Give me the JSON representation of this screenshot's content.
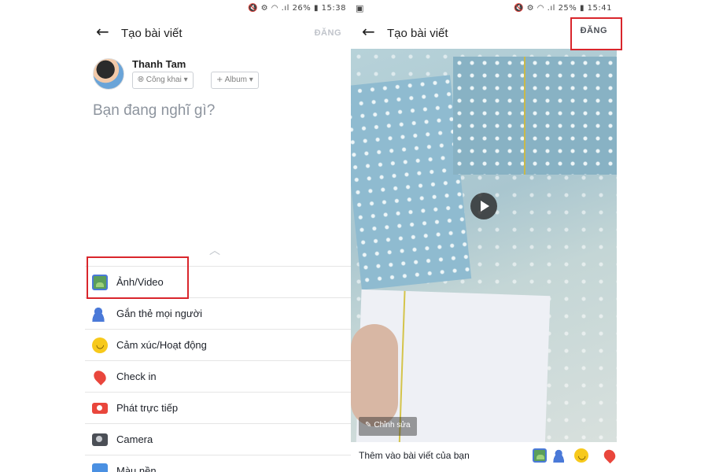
{
  "left": {
    "status": {
      "icons": "🔇 ⚙ 📶 26%",
      "battery": "26%",
      "time": "15:38"
    },
    "header": {
      "back_icon": "arrow-left-icon",
      "title": "Tạo bài viết",
      "post_label": "ĐĂNG"
    },
    "user": {
      "name": "Thanh Tam",
      "privacy": "Công khai",
      "album": "Album"
    },
    "composer_placeholder": "Bạn đang nghĩ gì?",
    "menu": [
      {
        "label": "Ảnh/Video",
        "icon": "photo-video-icon"
      },
      {
        "label": "Gắn thẻ mọi người",
        "icon": "tag-people-icon"
      },
      {
        "label": "Cảm xúc/Hoạt động",
        "icon": "feeling-emoji-icon"
      },
      {
        "label": "Check in",
        "icon": "location-pin-icon"
      },
      {
        "label": "Phát trực tiếp",
        "icon": "live-video-icon"
      },
      {
        "label": "Camera",
        "icon": "camera-icon"
      },
      {
        "label": "Màu nền",
        "icon": "background-color-icon"
      }
    ]
  },
  "right": {
    "status": {
      "battery": "25%",
      "time": "15:41"
    },
    "header": {
      "title": "Tạo bài viết",
      "post_label": "ĐĂNG"
    },
    "video": {
      "edit_label": "Chỉnh sửa"
    },
    "add_to_post_label": "Thêm vào bài viết của bạn"
  },
  "colors": {
    "highlight": "#d9262c",
    "disabled_post": "#c0c4cb"
  }
}
